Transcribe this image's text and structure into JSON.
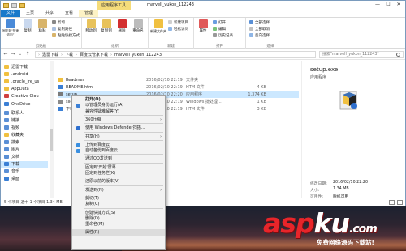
{
  "window": {
    "title": "marvell_yukon_112243",
    "context_tab_title": "应用程序工具",
    "controls": [
      "—",
      "☐",
      "✕"
    ]
  },
  "ribbon_tabs": [
    "文件",
    "主页",
    "共享",
    "查看",
    "管理"
  ],
  "ribbon": {
    "clipboard": {
      "pin_label": "固定到“快速访问”",
      "copy_label": "复制",
      "paste_label": "粘贴",
      "cut_label": "剪切",
      "copy_path_label": "复制路径",
      "paste_shortcut_label": "粘贴快捷方式",
      "group_label": "剪贴板"
    },
    "organize": {
      "move_label": "移动到",
      "copy_to_label": "复制到",
      "delete_label": "删除",
      "rename_label": "重命名",
      "group_label": "组织"
    },
    "new": {
      "new_folder_label": "新建文件夹",
      "new_item_label": "新建项目",
      "easy_access_label": "轻松访问",
      "group_label": "新建"
    },
    "open": {
      "properties_label": "属性",
      "open_label": "打开",
      "edit_label": "编辑",
      "history_label": "历史记录",
      "group_label": "打开"
    },
    "select": {
      "select_all_label": "全部选择",
      "select_none_label": "全部取消",
      "invert_label": "反向选择",
      "group_label": "选择"
    }
  },
  "address": {
    "path": [
      "迅雷下载",
      "下载",
      "百度云管家下载",
      "marvell_yukon_112243"
    ],
    "search_placeholder": "搜索\"marvell_yukon_112243\""
  },
  "sidebar": {
    "items": [
      {
        "label": "迅雷下载",
        "color": "#f0c040"
      },
      {
        "label": ".android",
        "color": "#f0c040"
      },
      {
        "label": ".oracle_jre_us",
        "color": "#f0c040"
      },
      {
        "label": "AppData",
        "color": "#f0c040"
      },
      {
        "label": "Creative Clou",
        "color": "#d04040"
      },
      {
        "label": "OneDrive",
        "color": "#3a7fd5"
      },
      {
        "label": "联系人",
        "color": "#5a8fd5"
      },
      {
        "label": "链接",
        "color": "#5a8fd5"
      },
      {
        "label": "视频",
        "color": "#5a8fd5"
      },
      {
        "label": "收藏夹",
        "color": "#f0c040"
      },
      {
        "label": "搜索",
        "color": "#5a8fd5"
      },
      {
        "label": "图片",
        "color": "#5a8fd5"
      },
      {
        "label": "文档",
        "color": "#5a8fd5"
      },
      {
        "label": "下载",
        "color": "#3a7fd5"
      },
      {
        "label": "音乐",
        "color": "#5a8fd5"
      },
      {
        "label": "桌面",
        "color": "#3a7fd5"
      }
    ],
    "selected_index": 13
  },
  "files": [
    {
      "name": "Readmes",
      "date": "2016/02/10 22:19",
      "type": "文件夹",
      "size": "",
      "icon_color": "#f0c040"
    },
    {
      "name": "README.htm",
      "date": "2016/02/10 22:19",
      "type": "HTM 文件",
      "size": "4 KB",
      "icon_color": "#3a7fd5"
    },
    {
      "name": "setup",
      "date": "2016/02/10 22:20",
      "type": "应用程序",
      "size": "1,374 KB",
      "icon_color": "#7a7a7a"
    },
    {
      "name": "silent",
      "date": "2016/02/10 22:19",
      "type": "Windows 批处理...",
      "size": "1 KB",
      "icon_color": "#8a8a8a"
    },
    {
      "name": "下载...",
      "date": "2016/02/10 22:19",
      "type": "HTM 文件",
      "size": "3 KB",
      "icon_color": "#3a7fd5"
    }
  ],
  "selected_file_index": 2,
  "preview": {
    "name": "setup.exe",
    "type": "应用程序",
    "modified_label": "修改日期:",
    "modified_value": "2016/02/10 22:20",
    "size_label": "大小:",
    "size_value": "1.34 MB",
    "availability_label": "可用性:",
    "availability_value": "脱机可用"
  },
  "status": {
    "text": "5 个项目    选中 1 个项目  1.34 MB"
  },
  "context_menu": [
    {
      "label": "打开(O)",
      "bold": true,
      "icon": ""
    },
    {
      "label": "以管理员身份运行(A)",
      "icon": "shield-icon",
      "icon_color": "#3a7fd5"
    },
    {
      "label": "兼容性疑难解答(Y)",
      "icon": ""
    },
    {
      "sep": true
    },
    {
      "label": "360压缩",
      "icon": "",
      "arrow": true
    },
    {
      "sep": true
    },
    {
      "label": "使用 Windows Defender扫描...",
      "icon": "defender-icon",
      "icon_color": "#2d6fcf"
    },
    {
      "sep": true
    },
    {
      "label": "共享(H)",
      "icon": "",
      "arrow": true
    },
    {
      "sep": true
    },
    {
      "label": "上传到百度云",
      "icon": "cloud-icon",
      "icon_color": "#3a8fe0"
    },
    {
      "label": "自动备份到百度云",
      "icon": "cloud-sync-icon",
      "icon_color": "#3a8fe0"
    },
    {
      "sep": true
    },
    {
      "label": "通过QQ发送到",
      "icon": ""
    },
    {
      "sep": true
    },
    {
      "label": "固定到'开始'屏幕",
      "icon": ""
    },
    {
      "label": "固定到任务栏(K)",
      "icon": ""
    },
    {
      "sep": true
    },
    {
      "label": "还原以前的版本(V)",
      "icon": ""
    },
    {
      "sep": true
    },
    {
      "label": "发送到(N)",
      "icon": "",
      "arrow": true
    },
    {
      "sep": true
    },
    {
      "label": "剪切(T)",
      "icon": ""
    },
    {
      "label": "复制(C)",
      "icon": ""
    },
    {
      "sep": true
    },
    {
      "label": "创建快捷方式(S)",
      "icon": ""
    },
    {
      "label": "删除(D)",
      "icon": ""
    },
    {
      "label": "重命名(M)",
      "icon": ""
    },
    {
      "sep": true
    },
    {
      "label": "属性(R)",
      "icon": "",
      "highlight": true
    }
  ],
  "watermark": {
    "logo_main": "asp",
    "logo_accent": "ku",
    "logo_tail": ".com",
    "tagline": "免费网络源码下载站!"
  }
}
